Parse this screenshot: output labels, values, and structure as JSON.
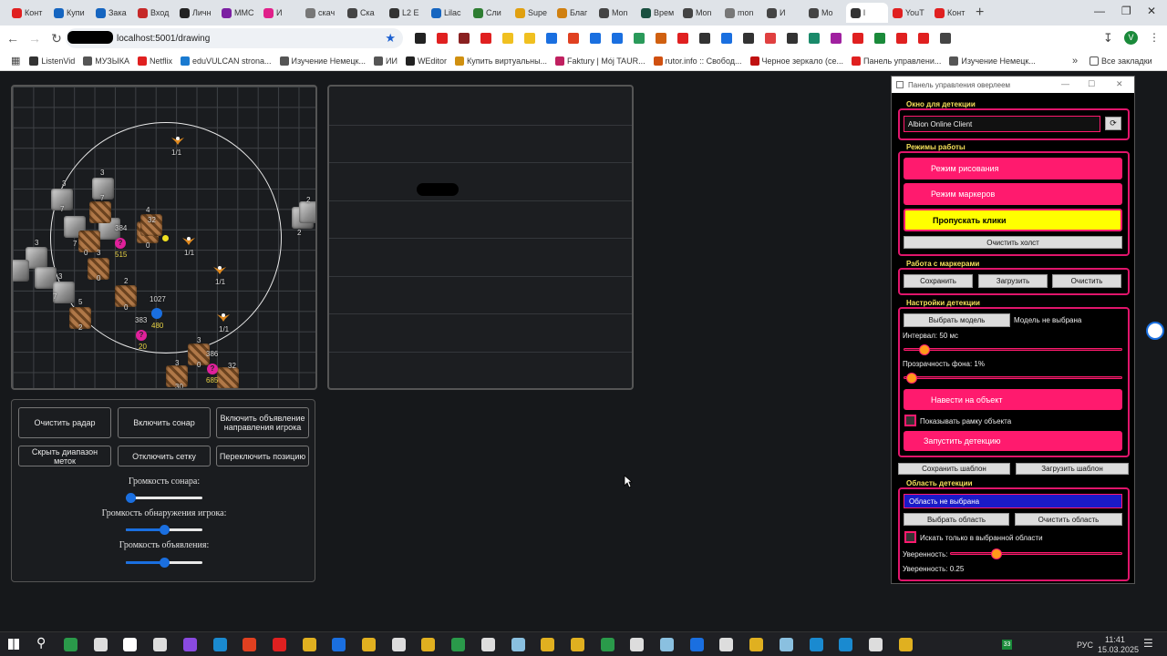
{
  "browser": {
    "tabs": [
      {
        "label": "Конт",
        "color": "#e02020"
      },
      {
        "label": "Купи",
        "color": "#1565c0"
      },
      {
        "label": "Зака",
        "color": "#1565c0"
      },
      {
        "label": "Вход",
        "color": "#c62828"
      },
      {
        "label": "Личн",
        "color": "#222222"
      },
      {
        "label": "MMC",
        "color": "#7b1fa2"
      },
      {
        "label": "И",
        "color": "#e0208a"
      },
      {
        "label": "скач",
        "color": "#777777"
      },
      {
        "label": "Ска",
        "color": "#444444"
      },
      {
        "label": "L2 E",
        "color": "#333333"
      },
      {
        "label": "Lilac",
        "color": "#1565c0"
      },
      {
        "label": "Сли",
        "color": "#2e7d32"
      },
      {
        "label": "Supe",
        "color": "#e0a010"
      },
      {
        "label": "Благ",
        "color": "#d08010"
      },
      {
        "label": "Mon",
        "color": "#444444"
      },
      {
        "label": "Врем",
        "color": "#1a5040"
      },
      {
        "label": "Mon",
        "color": "#444444"
      },
      {
        "label": "mon",
        "color": "#777777"
      },
      {
        "label": "И",
        "color": "#444444"
      },
      {
        "label": "Mo",
        "color": "#444444"
      },
      {
        "label": "l",
        "color": "#333333",
        "active": true
      },
      {
        "label": "YouT",
        "color": "#e02020"
      },
      {
        "label": "Конт",
        "color": "#e02020"
      }
    ],
    "new_tab": "+",
    "window_controls": {
      "minimize": "—",
      "maximize": "❐",
      "close": "✕"
    },
    "url": "localhost:5001/drawing",
    "bookmarks": [
      {
        "label": "ListenVid",
        "color": "#333333"
      },
      {
        "label": "МУЗЫКА",
        "color": "#555555"
      },
      {
        "label": "Netflix",
        "color": "#e02020"
      },
      {
        "label": "eduVULCAN strona...",
        "color": "#1a7ad0"
      },
      {
        "label": "Изучение Немецк...",
        "color": "#555555"
      },
      {
        "label": "ИИ",
        "color": "#555555"
      },
      {
        "label": "WEditor",
        "color": "#222222"
      },
      {
        "label": "Купить виртуальны...",
        "color": "#d09010"
      },
      {
        "label": "Faktury | Mój TAUR...",
        "color": "#c02060"
      },
      {
        "label": "rutor.info :: Свобод...",
        "color": "#d05010"
      },
      {
        "label": "Черное зеркало (се...",
        "color": "#c01010"
      },
      {
        "label": "Панель управлени...",
        "color": "#e02020"
      },
      {
        "label": "Изучение Немецк...",
        "color": "#555555"
      }
    ],
    "all_bookmarks": "Все закладки",
    "more": "»"
  },
  "radar": {
    "eagles": [
      {
        "label": "1/1"
      },
      {
        "label": "1/1"
      },
      {
        "label": "1/1"
      },
      {
        "label": "1/1"
      }
    ],
    "stone_counts": [
      "3",
      "7",
      "3",
      "7",
      "2",
      "7",
      "3",
      "2",
      "2",
      "3",
      "7",
      "3"
    ],
    "wood_counts": [
      "4",
      "32",
      "0",
      "384",
      "0",
      "3",
      "0",
      "0",
      "5",
      "2",
      "3",
      "0",
      "386",
      "0",
      "32",
      "30",
      "3"
    ],
    "points": [
      {
        "number": "1027",
        "value": "480",
        "color": "#1a6fe0"
      },
      {
        "symbol": "?",
        "number": "384",
        "value": "515",
        "color": "#e0209a"
      },
      {
        "symbol": "?",
        "number": "383",
        "value": "20",
        "color": "#e0209a"
      },
      {
        "symbol": "?",
        "value": "685",
        "color": "#e0209a"
      }
    ]
  },
  "controls": {
    "buttons": [
      "Очистить радар",
      "Включить сонар",
      "Включить объявление направления игрока",
      "Скрыть диапазон меток",
      "Отключить сетку",
      "Переключить позицию"
    ],
    "sliders": [
      {
        "label": "Громкость сонара:",
        "value": 0.0
      },
      {
        "label": "Громкость обнаружения игрока:",
        "value": 0.5
      },
      {
        "label": "Громкость объявления:",
        "value": 0.5
      }
    ]
  },
  "overlay": {
    "title": "Панель управления оверлеем",
    "window_controls": {
      "minimize": "—",
      "maximize": "☐",
      "close": "✕"
    },
    "detect_window": {
      "title": "Окно для детекции",
      "value": "Albion Online Client",
      "refresh": "⟳"
    },
    "modes": {
      "title": "Режимы работы",
      "draw": "Режим рисования",
      "markers": "Режим маркеров",
      "passthrough": "Пропускать клики",
      "clear_canvas": "Очистить холст"
    },
    "markers": {
      "title": "Работа с маркерами",
      "save": "Сохранить",
      "load": "Загрузить",
      "clear": "Очистить"
    },
    "detection": {
      "title": "Настройки детекции",
      "choose_model": "Выбрать модель",
      "model_status": "Модель не выбрана",
      "interval": "Интервал: 50 мс",
      "interval_value": 0.07,
      "opacity": "Прозрачность фона: 1%",
      "opacity_value": 0.01,
      "aim": "Навести на объект",
      "show_frame": "Показывать рамку объекта",
      "start": "Запустить детекцию"
    },
    "templates": {
      "save": "Сохранить шаблон",
      "load": "Загрузить шаблон"
    },
    "area": {
      "title": "Область детекции",
      "status": "Область не выбрана",
      "select": "Выбрать область",
      "clear": "Очистить область",
      "only_area": "Искать только в выбранной области",
      "confidence_label": "Уверенность:",
      "confidence_value": 0.25,
      "confidence_text": "Уверенность: 0.25"
    }
  },
  "taskbar": {
    "language": "РУС",
    "time": "11:41",
    "date": "15.03.2025",
    "badge": "33"
  },
  "colors": {
    "accent_pink": "#ff1a6e",
    "yellow_button": "#ffff00",
    "area_blue": "#1a1ac8",
    "title_yellow": "#f5e05a"
  }
}
